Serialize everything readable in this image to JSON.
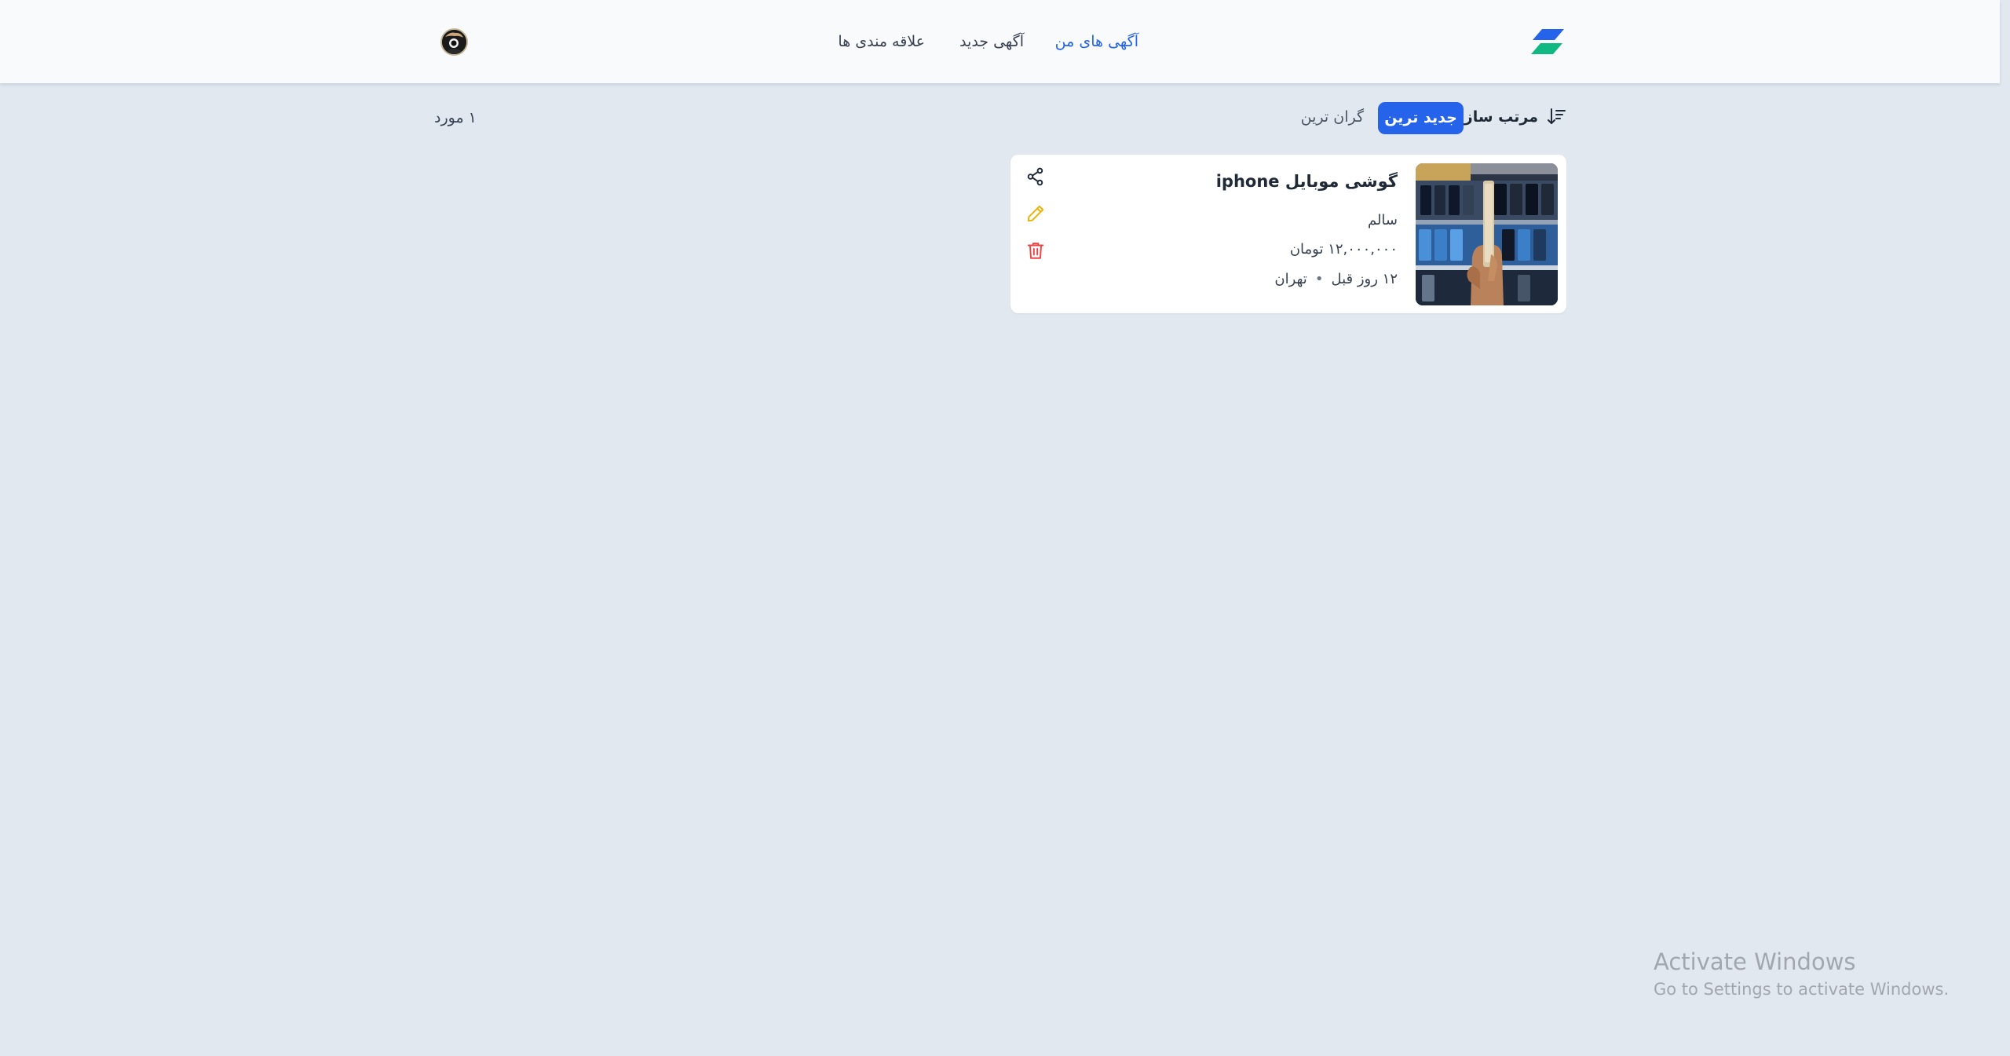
{
  "header": {
    "nav": {
      "my_ads": "آگهی های من",
      "new_ad": "آگهی جدید",
      "favorites": "علاقه مندی ها"
    }
  },
  "sort": {
    "label": "مرتب سازی",
    "options": {
      "newest": "جدید ترین",
      "priciest": "گران ترین"
    },
    "selected": "جدید ترین"
  },
  "results": {
    "count_text": "۱ مورد"
  },
  "ads": [
    {
      "title": "گوشی موبایل iphone",
      "condition": "سالم",
      "price": "۱۲,۰۰۰,۰۰۰",
      "currency": "تومان",
      "time_ago": "۱۲ روز قبل",
      "separator": "•",
      "location": "تهران"
    }
  ],
  "watermark": {
    "title": "Activate Windows",
    "subtitle": "Go to Settings to activate Windows."
  },
  "colors": {
    "accent": "#2563eb",
    "page_background": "#e2e8f0",
    "header_background": "#f8fafc",
    "edit_icon": "#eab308",
    "delete_icon": "#ef4444",
    "logo_blue": "#2563eb",
    "logo_green": "#10b981"
  },
  "icons": {
    "logo": "brand-logo-icon",
    "avatar": "user-avatar",
    "sort": "sort-descending-icon",
    "share": "share-icon",
    "edit": "pencil-icon",
    "delete": "trash-icon"
  }
}
